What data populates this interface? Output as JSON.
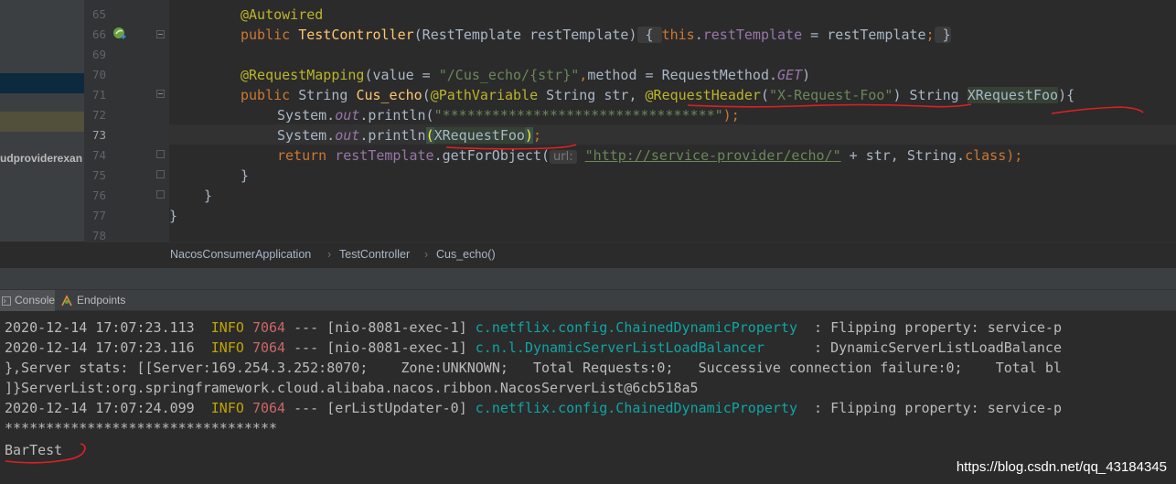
{
  "project": {
    "truncated_label": "udproviderexan"
  },
  "editor": {
    "line_numbers": [
      "65",
      "66",
      "69",
      "70",
      "71",
      "72",
      "73",
      "74",
      "75",
      "76",
      "77",
      "78"
    ],
    "current_line": "73",
    "code": {
      "l65_anno": "@Autowired",
      "l66_public": "public ",
      "l66_ctor": "TestController",
      "l66_params": "(RestTemplate restTemplate)",
      "l66_open": " { ",
      "l66_this": "this",
      "l66_dot": ".",
      "l66_field": "restTemplate",
      "l66_assign": " = restTemplate",
      "l66_semi": ";",
      "l66_close": " }",
      "l70_anno": "@RequestMapping",
      "l70_p1": "(value = ",
      "l70_str": "\"/Cus_echo/{str}\"",
      "l70_comma": ",",
      "l70_p2": "method = RequestMethod.",
      "l70_get": "GET",
      "l70_p3": ")",
      "l71_public": "public ",
      "l71_type": "String ",
      "l71_method": "Cus_echo",
      "l71_p1": "(",
      "l71_pathvar": "@PathVariable",
      "l71_p2": " String str, ",
      "l71_reqhdr": "@RequestHeader",
      "l71_p3": "(",
      "l71_hdrstr": "\"X-Request-Foo\"",
      "l71_p4": ") String ",
      "l71_param": "XRequestFoo",
      "l71_p5": "){",
      "l72_sys": "System.",
      "l72_out": "out",
      "l72_println": ".println(",
      "l72_str": "\"*********************************\"",
      "l72_end": ");",
      "l73_sys": "System.",
      "l73_out": "out",
      "l73_println": ".println",
      "l73_open": "(",
      "l73_arg": "XRequestFoo",
      "l73_close": ")",
      "l73_semi": ";",
      "l74_return": "return ",
      "l74_field": "restTemplate",
      "l74_call": ".getForObject(",
      "l74_hint": "url:",
      "l74_url": "\"http://service-provider/echo/\"",
      "l74_rest": " + str, String.",
      "l74_class": "class",
      "l74_end": ");",
      "l75": "}",
      "l76": "}",
      "l77": "}"
    }
  },
  "breadcrumb": {
    "items": [
      "NacosConsumerApplication",
      "TestController",
      "Cus_echo()"
    ]
  },
  "tool_tabs": {
    "console_label": "Console",
    "endpoints_label": "Endpoints"
  },
  "console": {
    "lines": [
      {
        "ts": "2020-12-14 17:07:23.113",
        "level": "INFO",
        "pid": "7064",
        "sep": "---",
        "thread": "[nio-8081-exec-1]",
        "cls": "c.netflix.config.ChainedDynamicProperty",
        "msg": ": Flipping property: service-p"
      },
      {
        "ts": "2020-12-14 17:07:23.116",
        "level": "INFO",
        "pid": "7064",
        "sep": "---",
        "thread": "[nio-8081-exec-1]",
        "cls": "c.n.l.DynamicServerListLoadBalancer",
        "msg": ": DynamicServerListLoadBalance"
      },
      {
        "text": "},Server stats: [[Server:169.254.3.252:8070;    Zone:UNKNOWN;   Total Requests:0;   Successive connection failure:0;    Total bl"
      },
      {
        "text": "]}ServerList:org.springframework.cloud.alibaba.nacos.ribbon.NacosServerList@6cb518a5"
      },
      {
        "ts": "2020-12-14 17:07:24.099",
        "level": "INFO",
        "pid": "7064",
        "sep": "---",
        "thread": "[erListUpdater-0]",
        "cls": "c.netflix.config.ChainedDynamicProperty",
        "msg": ": Flipping property: service-p"
      },
      {
        "text": "*********************************"
      },
      {
        "text": "BarTest"
      }
    ]
  },
  "watermark": "https://blog.csdn.net/qq_43184345",
  "colors": {
    "background": "#2b2b2b",
    "keyword": "#cc7832",
    "annotation": "#bbb529",
    "string": "#6a8759",
    "method": "#ffc66d",
    "info": "#c2a400",
    "class": "#0fa5a5",
    "red_mark": "#e02020"
  }
}
